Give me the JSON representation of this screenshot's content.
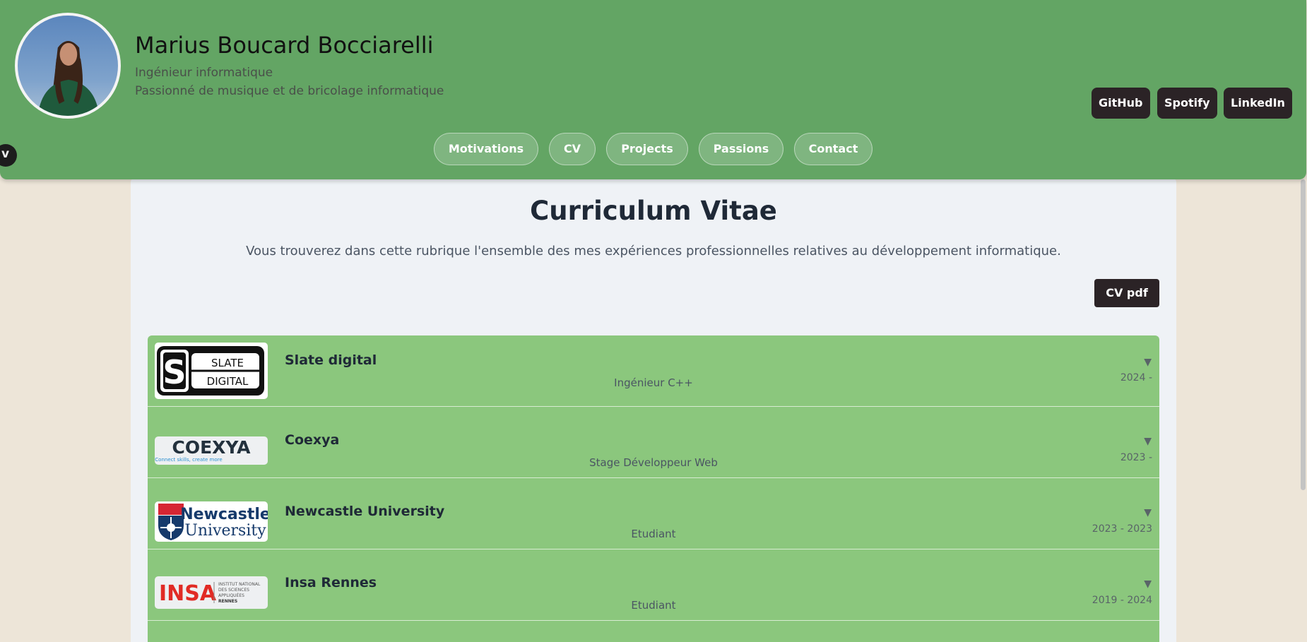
{
  "profile": {
    "name": "Marius Boucard Bocciarelli",
    "title": "Ingénieur informatique",
    "tagline": "Passionné de musique et de bricolage informatique"
  },
  "social": [
    {
      "label": "GitHub"
    },
    {
      "label": "Spotify"
    },
    {
      "label": "LinkedIn"
    }
  ],
  "nav": [
    {
      "label": "Motivations"
    },
    {
      "label": "CV"
    },
    {
      "label": "Projects"
    },
    {
      "label": "Passions"
    },
    {
      "label": "Contact"
    }
  ],
  "toggle_icon": "chevron-down-icon",
  "cv": {
    "title": "Curriculum Vitae",
    "description": "Vous trouverez dans cette rubrique l'ensemble des mes expériences professionnelles relatives au développement informatique.",
    "pdf_label": "CV pdf"
  },
  "experiences": [
    {
      "company": "Slate digital",
      "role": "Ingénieur C++",
      "dates": "2024 -",
      "logo_text": [
        "SLATE",
        "DIGITAL"
      ]
    },
    {
      "company": "Coexya",
      "role": "Stage Développeur Web",
      "dates": "2023 -",
      "logo_text": [
        "COEXYA",
        "Connect skills, create more"
      ]
    },
    {
      "company": "Newcastle University",
      "role": "Etudiant",
      "dates": "2023 - 2023",
      "logo_text": [
        "Newcastle",
        "University"
      ]
    },
    {
      "company": "Insa Rennes",
      "role": "Etudiant",
      "dates": "2019 - 2024",
      "logo_text": [
        "INSA",
        "INSTITUT NATIONAL",
        "DES SCIENCES",
        "APPLIQUÉES",
        "RENNES"
      ]
    }
  ],
  "expand_icon": "▼",
  "colors": {
    "header_bg": "#63a564",
    "card_bg": "#8bc77d",
    "dark_button": "#2b2326",
    "page_bg": "#ede5d8"
  }
}
